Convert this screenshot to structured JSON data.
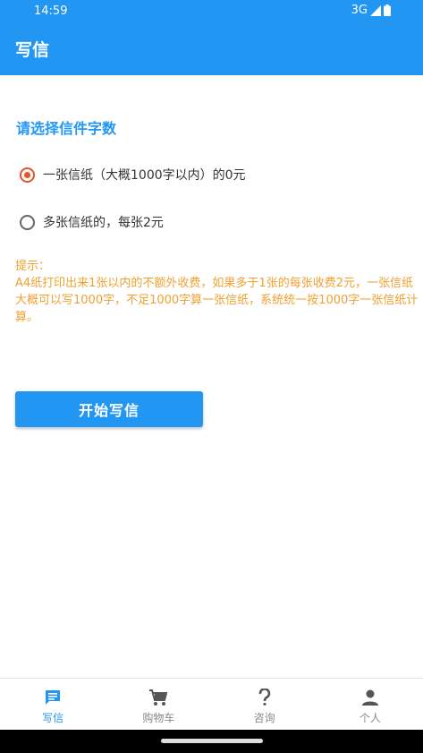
{
  "status_bar": {
    "time": "14:59",
    "network": "3G"
  },
  "app_bar": {
    "title": "写信"
  },
  "section": {
    "title": "请选择信件字数"
  },
  "options": [
    {
      "label": "一张信纸（大概1000字以内）的0元",
      "selected": true
    },
    {
      "label": "多张信纸的，每张2元",
      "selected": false
    }
  ],
  "tips": {
    "heading": "提示：",
    "body": "A4纸打印出来1张以内的不额外收费，如果多于1张的每张收费2元，一张信纸大概可以写1000字，不足1000字算一张信纸，系统统一按1000字一张信纸计算。"
  },
  "start_button": {
    "label": "开始写信"
  },
  "bottom_nav": [
    {
      "label": "写信",
      "icon": "message-icon",
      "active": true
    },
    {
      "label": "购物车",
      "icon": "cart-icon",
      "active": false
    },
    {
      "label": "咨询",
      "icon": "question-icon",
      "active": false
    },
    {
      "label": "个人",
      "icon": "person-icon",
      "active": false
    }
  ],
  "colors": {
    "primary": "#2196F3",
    "radio_selected": "#E5532B",
    "tips": "#F0A030"
  }
}
